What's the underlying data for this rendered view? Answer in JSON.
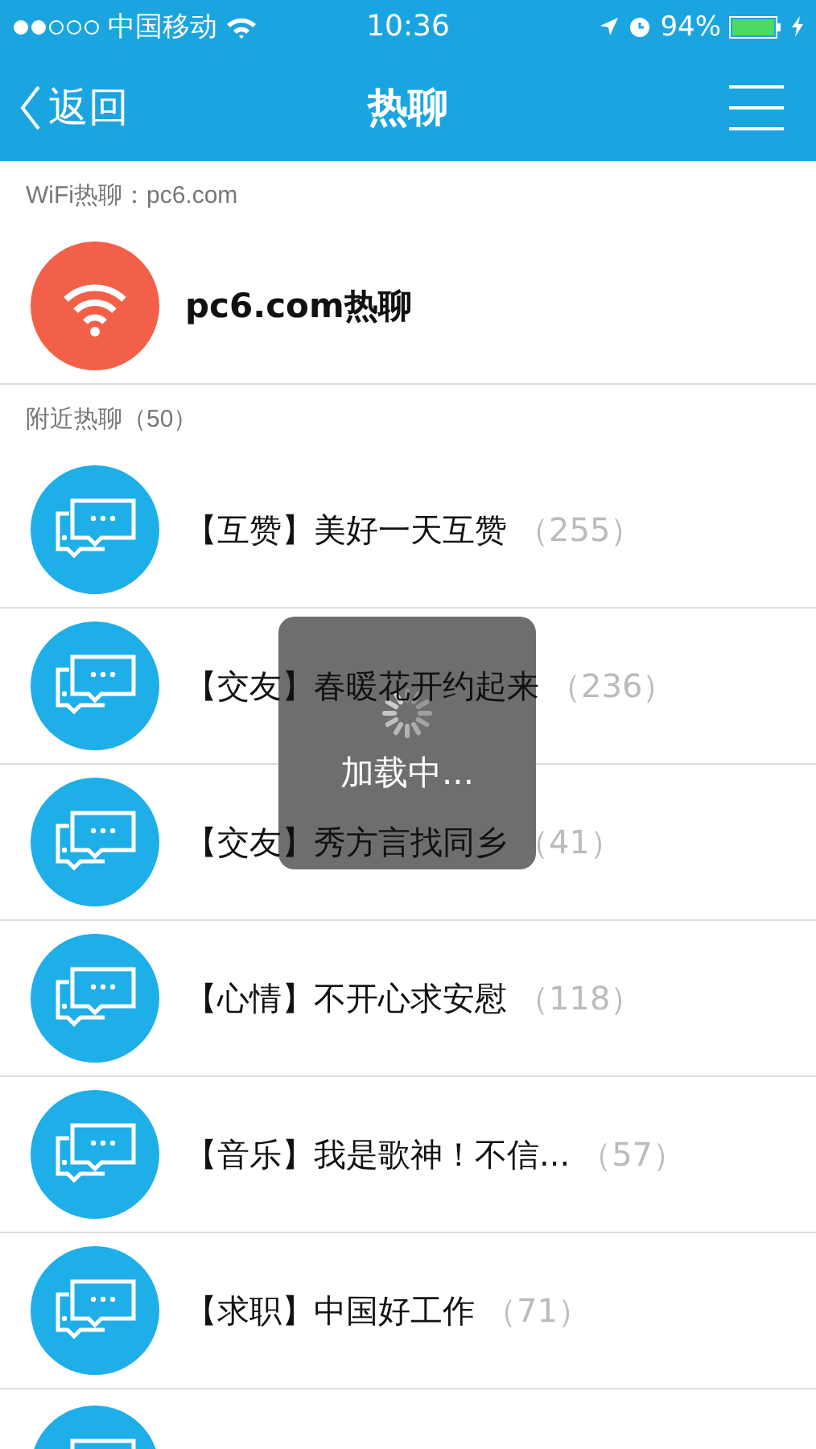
{
  "status_bar": {
    "carrier": "中国移动",
    "time": "10:36",
    "battery": "94%"
  },
  "nav": {
    "back": "返回",
    "title": "热聊"
  },
  "wifi_section": {
    "header": "WiFi热聊：pc6.com",
    "rooms": [
      {
        "title": "pc6.com热聊"
      }
    ]
  },
  "nearby_section": {
    "header": "附近热聊（50）",
    "rooms": [
      {
        "kind": "room",
        "title": "【互赞】美好一天互赞",
        "count": "（255）"
      },
      {
        "kind": "room",
        "title": "【交友】春暖花开约起来",
        "count": "（236）"
      },
      {
        "kind": "room",
        "title": "【交友】秀方言找同乡",
        "count": "（41）"
      },
      {
        "kind": "room",
        "title": "【心情】不开心求安慰",
        "count": "（118）"
      },
      {
        "kind": "room",
        "title": "【音乐】我是歌神！不信...",
        "count": "（57）"
      },
      {
        "kind": "room",
        "title": "【求职】中国好工作",
        "count": "（71）"
      },
      {
        "kind": "cut_off"
      }
    ]
  },
  "loading": {
    "text": "加载中..."
  }
}
